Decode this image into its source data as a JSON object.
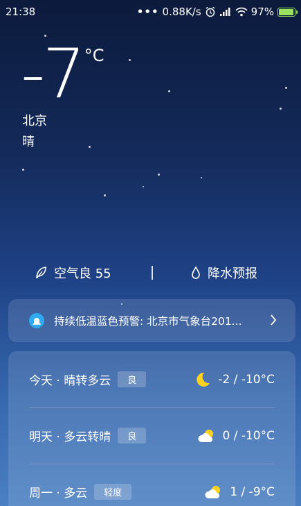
{
  "status_bar": {
    "time": "21:38",
    "dots": "•••",
    "speed": "0.88K/s",
    "battery": "97%",
    "battery_level": 0.97,
    "icons": [
      "alarm-icon",
      "signal-icon",
      "wifi-icon",
      "battery-icon"
    ]
  },
  "current": {
    "temp": "-7",
    "unit": "°C",
    "city": "北京",
    "condition": "晴"
  },
  "info": {
    "air_label": "空气良 55",
    "rain_label": "降水预报"
  },
  "alert": {
    "text": "持续低温蓝色预警: 北京市气象台201..."
  },
  "forecast": [
    {
      "day": "今天 · 晴转多云",
      "badge": "良",
      "icon": "moon-icon",
      "range": "-2 / -10°C"
    },
    {
      "day": "明天 · 多云转晴",
      "badge": "良",
      "icon": "cloud-sun-icon",
      "range": "0 / -10°C"
    },
    {
      "day": "周一 · 多云",
      "badge": "轻度",
      "icon": "cloud-sun-icon",
      "range": "1 / -9°C"
    }
  ],
  "colors": {
    "accent_blue": "#2fa9f0",
    "battery_green": "#9be15d",
    "moon_yellow": "#ffd21f"
  }
}
